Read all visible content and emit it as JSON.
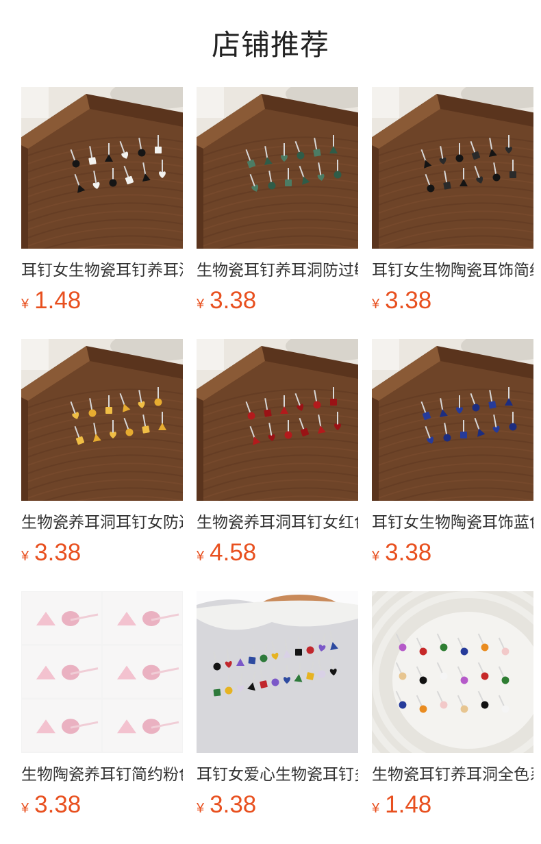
{
  "page": {
    "title": "店铺推荐"
  },
  "products": [
    {
      "name": "耳钉女生物瓷耳钉养耳洞",
      "currency": "¥",
      "price": "1.48",
      "scene": "wood",
      "colors": [
        "#151515",
        "#f3f3f0"
      ]
    },
    {
      "name": "生物瓷耳钉养耳洞防过敏",
      "currency": "¥",
      "price": "3.38",
      "scene": "wood",
      "colors": [
        "#4c7c64",
        "#2f5c48"
      ]
    },
    {
      "name": "耳钉女生物陶瓷耳饰简约",
      "currency": "¥",
      "price": "3.38",
      "scene": "wood",
      "colors": [
        "#141414",
        "#2a2a2a"
      ]
    },
    {
      "name": "生物瓷养耳洞耳钉女防过敏",
      "currency": "¥",
      "price": "3.38",
      "scene": "wood",
      "colors": [
        "#f0be45",
        "#e7ac30"
      ]
    },
    {
      "name": "生物瓷养耳洞耳钉女红色",
      "currency": "¥",
      "price": "4.58",
      "scene": "wood",
      "colors": [
        "#b31a1c",
        "#9a1215"
      ]
    },
    {
      "name": "耳钉女生物陶瓷耳饰蓝色",
      "currency": "¥",
      "price": "3.38",
      "scene": "wood",
      "colors": [
        "#263b9a",
        "#1c2d80"
      ]
    },
    {
      "name": "生物陶瓷养耳钉简约粉色",
      "currency": "¥",
      "price": "3.38",
      "scene": "pink",
      "colors": [
        "#f3c2cf",
        "#eab1c1"
      ]
    },
    {
      "name": "耳钉女爱心生物瓷耳钉多色",
      "currency": "¥",
      "price": "3.38",
      "scene": "paper",
      "colors": [
        "#141414",
        "#c1272d",
        "#7b58c8",
        "#2d4aa0",
        "#2e7a3b",
        "#e6b321",
        "#d9d1e6"
      ]
    },
    {
      "name": "生物瓷耳钉养耳洞全色系",
      "currency": "¥",
      "price": "1.48",
      "scene": "plate",
      "colors": [
        "#b55ac9",
        "#c62828",
        "#2e7d32",
        "#263b9a",
        "#e98b1f",
        "#f2c9c9",
        "#e7c590",
        "#111111",
        "#f5f5f5"
      ]
    }
  ]
}
